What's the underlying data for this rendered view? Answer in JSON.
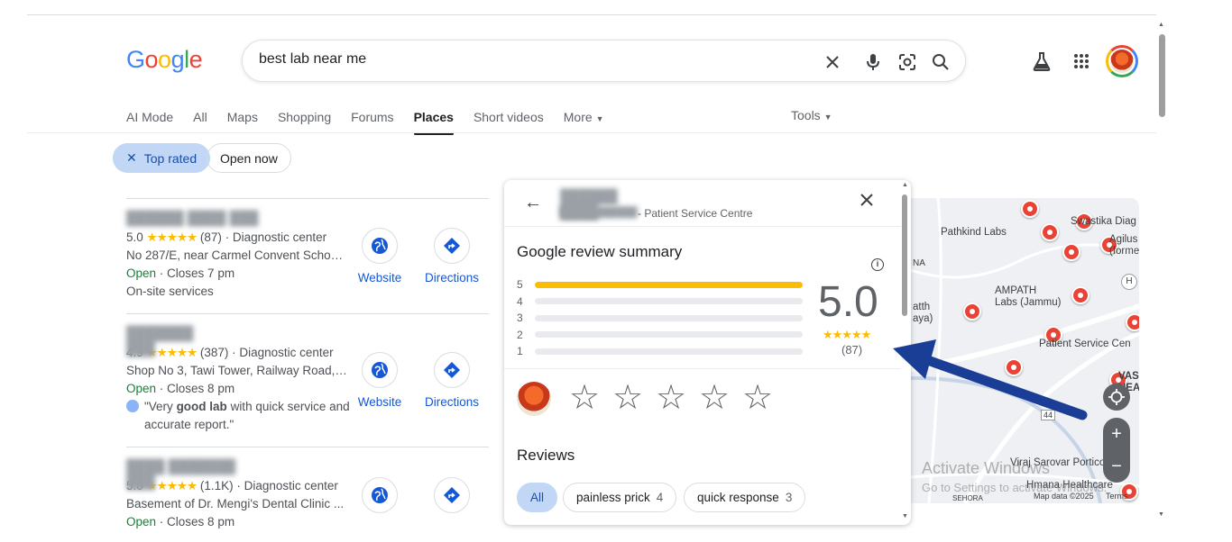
{
  "search": {
    "query": "best lab near me"
  },
  "tabs": [
    "AI Mode",
    "All",
    "Maps",
    "Shopping",
    "Forums",
    "Places",
    "Short videos",
    "More"
  ],
  "tools_label": "Tools",
  "filters": {
    "top_rated": "Top rated",
    "open_now": "Open now"
  },
  "results": [
    {
      "rating": "5.0",
      "stars": "★★★★★",
      "reviews": "(87)",
      "category": "· Diagnostic center",
      "address": "No 287/E, near Carmel Convent School...",
      "open": "Open",
      "hours": "· Closes 7 pm",
      "extra": "On-site services",
      "website": "Website",
      "directions": "Directions"
    },
    {
      "rating": "4.9",
      "stars": "★★★★★",
      "reviews": "(387)",
      "category": "· Diagnostic center",
      "address": "Shop No 3, Tawi Tower, Railway Road, ...",
      "open": "Open",
      "hours": "· Closes 8 pm",
      "quote_pre": "\"Very ",
      "quote_bold": "good lab",
      "quote_post": " with quick service and",
      "quote_line2": "accurate report.\"",
      "website": "Website",
      "directions": "Directions"
    },
    {
      "rating": "5.0",
      "stars": "★★★★★",
      "reviews": "(1.1K)",
      "category": "· Diagnostic center",
      "address": "Basement of Dr. Mengi's Dental Clinic ...",
      "open": "Open",
      "hours": "· Closes 8 pm"
    }
  ],
  "card": {
    "subtitle": "- Patient Service Centre",
    "summary_title": "Google review summary",
    "bar_labels": [
      "5",
      "4",
      "3",
      "2",
      "1"
    ],
    "bar_fractions": [
      1.0,
      0,
      0,
      0,
      0
    ],
    "rating": "5.0",
    "stars": "★★★★★",
    "count": "(87)",
    "reviews_title": "Reviews",
    "tags": [
      {
        "label": "All",
        "count": ""
      },
      {
        "label": "painless prick",
        "count": "4"
      },
      {
        "label": "quick response",
        "count": "3"
      }
    ]
  },
  "map": {
    "labels": {
      "swastika": "Swastika Diag",
      "pathkind": "Pathkind Labs",
      "agilus1": "Agilus D",
      "agilus2": "(formerly",
      "na": "NA",
      "ampath1": "AMPATH",
      "ampath2": "Labs (Jammu)",
      "atth": "atth",
      "aya": "aya)",
      "psc": "Patient Service Cen",
      "vasuk1": "VASUK",
      "vasuk2": "HEALTH",
      "road": "44",
      "viraj": "Viraj Sarovar Portico",
      "hmana": "Hmana Healthcare",
      "sehora": "SEHORA",
      "mapdata": "Map data ©2025",
      "terms": "Terms",
      "h": "H"
    }
  },
  "watermark": {
    "line1": "Activate Windows",
    "line2": "Go to Settings to activate Windows."
  },
  "colors": {
    "accent": "#1a73e8",
    "star": "#fbbc04",
    "open": "#188038",
    "chip_selected": "#c2d7f6",
    "arrow": "#1a3e96"
  }
}
